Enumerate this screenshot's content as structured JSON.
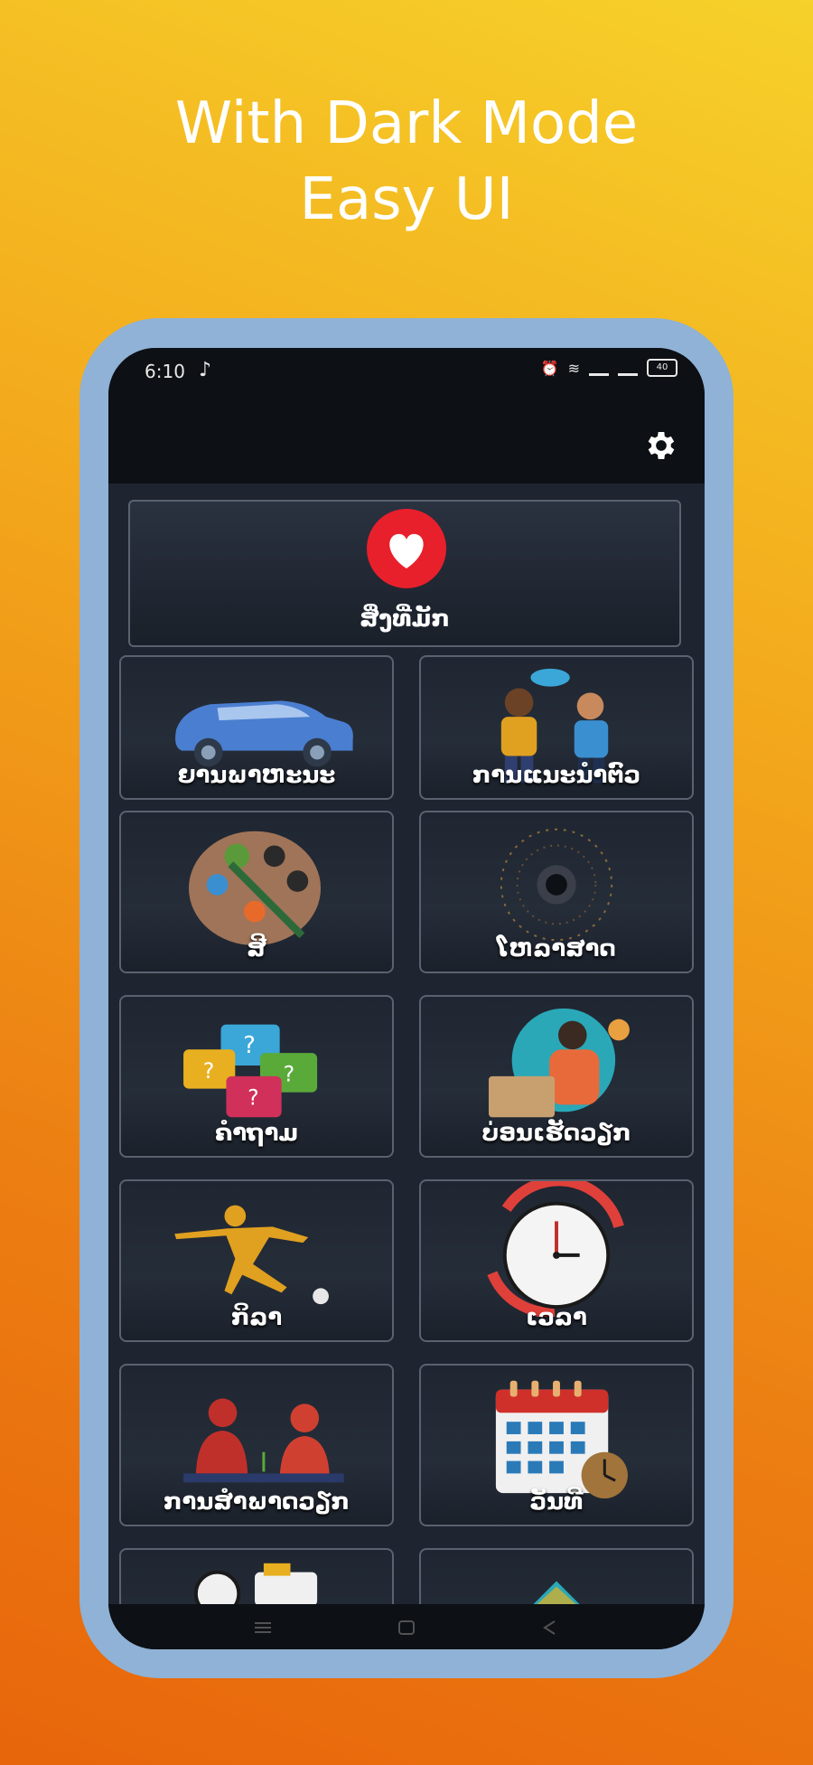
{
  "promo": {
    "line1": "With Dark Mode",
    "line2": "Easy UI"
  },
  "status_bar": {
    "time": "6:10",
    "note_icon": "music-note-icon",
    "battery_level": "40"
  },
  "app_bar": {
    "settings_icon": "gear-icon"
  },
  "favorites": {
    "label": "ສິ່ງທີ່ມັກ",
    "icon": "heart-icon",
    "color": "#e8202c"
  },
  "categories": [
    {
      "label": "ຍານພາຫະນະ",
      "icon": "car-icon"
    },
    {
      "label": "ການແນະນຳຕົວ",
      "icon": "greeting-people-icon"
    },
    {
      "label": "ສີ",
      "icon": "paint-palette-icon"
    },
    {
      "label": "ໂຫລາສາດ",
      "icon": "zodiac-wheel-icon"
    },
    {
      "label": "ຄຳຖາມ",
      "icon": "question-bubbles-icon"
    },
    {
      "label": "ບ່ອນເຮັດວຽກ",
      "icon": "workplace-icon"
    },
    {
      "label": "ກິລາ",
      "icon": "soccer-player-icon"
    },
    {
      "label": "ເວລາ",
      "icon": "clock-icon"
    },
    {
      "label": "ການສຳພາດວຽກ",
      "icon": "job-interview-icon"
    },
    {
      "label": "ວັນທີ",
      "icon": "calendar-icon"
    },
    {
      "label": "",
      "icon": "transport-icon"
    },
    {
      "label": "",
      "icon": "tent-icon"
    }
  ],
  "colors": {
    "screen_bg": "#1e2530",
    "bar_bg": "#0d1014",
    "card_border": "#5a6270",
    "frame": "#8fb2d6"
  }
}
